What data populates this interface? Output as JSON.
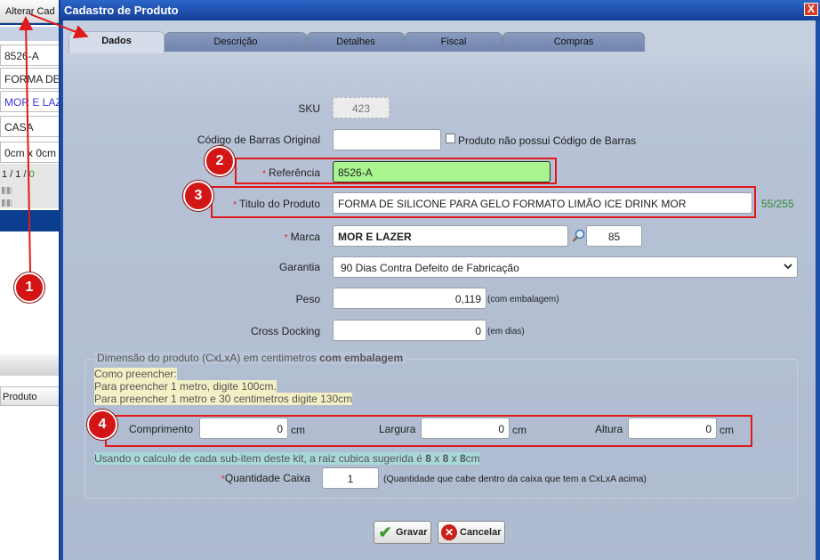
{
  "background": {
    "top_button": "Alterar Cad",
    "fields": [
      "8526-A",
      "FORMA DE",
      "MOR E LAZ",
      "CASA",
      "0cm x 0cm"
    ],
    "paging_prefix": "1 / 1 / ",
    "paging_count": "0",
    "column_header": "Produto"
  },
  "dialog": {
    "title": "Cadastro de Produto",
    "close": "X",
    "tabs": [
      "Dados",
      "Descrição",
      "Detalhes",
      "Fiscal",
      "Compras"
    ],
    "sku": {
      "label": "SKU",
      "value": "423"
    },
    "barcode": {
      "label": "Código de Barras Original",
      "value": "",
      "checkbox_label": "Produto não possui Código de Barras"
    },
    "referencia": {
      "required": "*",
      "label": "Referência",
      "value": "8526-A"
    },
    "titulo": {
      "required": "*",
      "label": "Titulo do Produto",
      "value": "FORMA DE SILICONE PARA GELO FORMATO LIMÃO ICE DRINK MOR",
      "counter": "55/255"
    },
    "marca": {
      "required": "*",
      "label": "Marca",
      "value": "MOR E LAZER",
      "code": "85"
    },
    "garantia": {
      "label": "Garantia",
      "value": "90 Dias Contra Defeito de Fabricação"
    },
    "peso": {
      "label": "Peso",
      "value": "0,119",
      "unit": "(com embalagem)"
    },
    "crossdocking": {
      "label": "Cross Docking",
      "value": "0",
      "unit": "(em dias)"
    },
    "dimensao": {
      "legend_prefix": "Dimensão do produto (CxLxA) em centimetros ",
      "legend_bold": "com embalagem",
      "help": [
        "Como preencher:",
        "Para preencher 1 metro, digite 100cm.",
        "Para preencher 1 metro e 30 centimetros digite 130cm"
      ],
      "comprimento": {
        "label": "Comprimento",
        "value": "0",
        "unit": "cm"
      },
      "largura": {
        "label": "Largura",
        "value": "0",
        "unit": "cm"
      },
      "altura": {
        "label": "Altura",
        "value": "0",
        "unit": "cm"
      },
      "sugestao_prefix": "Usando o calculo de cada sub-item deste kit, a raiz cubica sugerida é ",
      "sugestao_a": "8",
      "sugestao_x1": " x ",
      "sugestao_b": "8",
      "sugestao_x2": " x ",
      "sugestao_c": "8",
      "sugestao_suffix": "cm"
    },
    "quantidade": {
      "required": "*",
      "label": "Quantidade Caixa",
      "value": "1",
      "hint": "(Quantidade que cabe dentro da caixa que tem a CxLxA acima)"
    },
    "buttons": {
      "save": "Gravar",
      "cancel": "Cancelar"
    }
  },
  "annotations": [
    "1",
    "2",
    "3",
    "4"
  ],
  "colors": {
    "accent": "#1c4fa8",
    "highlight_field": "#a8f58f",
    "annotation": "#d41515"
  }
}
